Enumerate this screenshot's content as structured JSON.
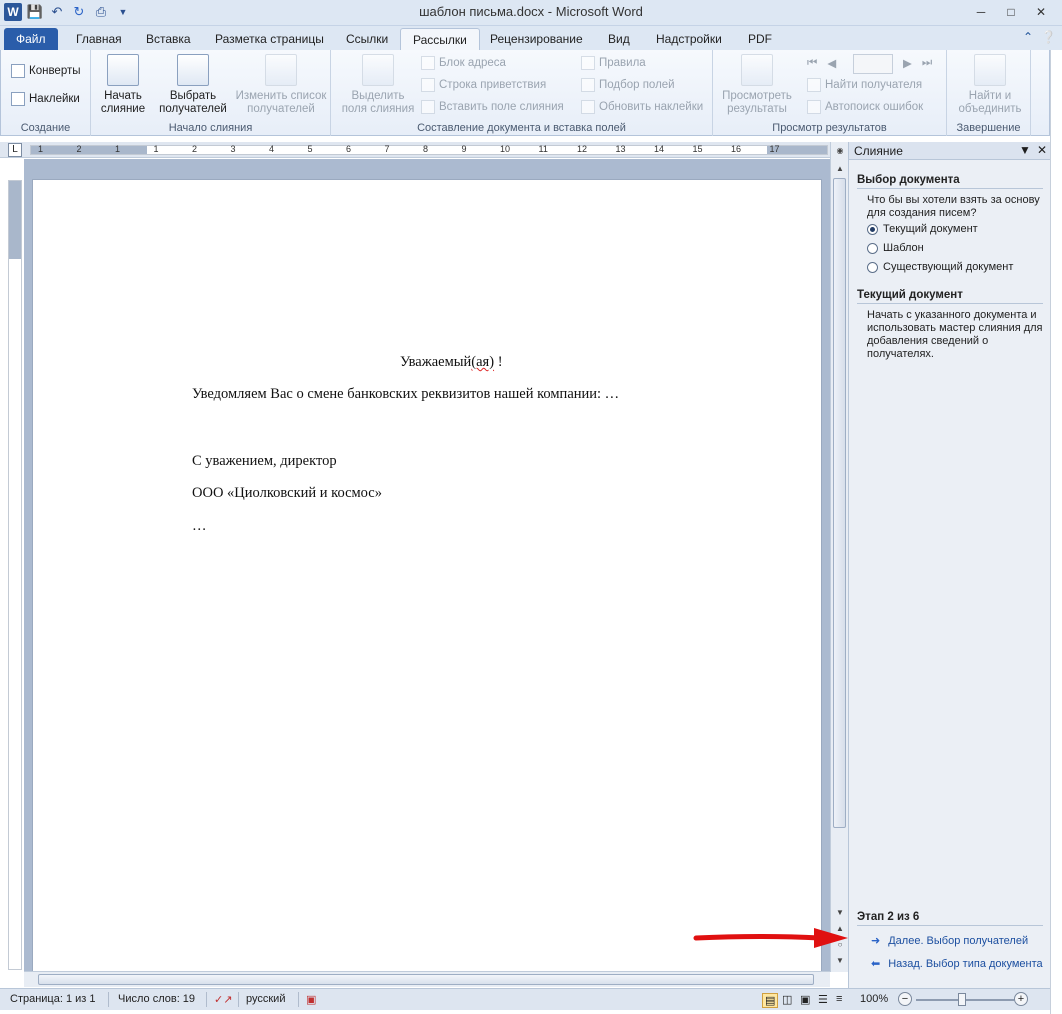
{
  "window": {
    "title": "шаблон письма.docx - Microsoft Word"
  },
  "tabs": [
    {
      "label": "Файл"
    },
    {
      "label": "Главная"
    },
    {
      "label": "Вставка"
    },
    {
      "label": "Разметка страницы"
    },
    {
      "label": "Ссылки"
    },
    {
      "label": "Рассылки"
    },
    {
      "label": "Рецензирование"
    },
    {
      "label": "Вид"
    },
    {
      "label": "Надстройки"
    },
    {
      "label": "PDF"
    }
  ],
  "ribbon": {
    "create": {
      "label": "Создание",
      "envelopes": "Конверты",
      "labels": "Наклейки"
    },
    "start_merge": {
      "label": "Начало слияния",
      "start_line1": "Начать",
      "start_line2": "слияние",
      "select_line1": "Выбрать",
      "select_line2": "получателей",
      "edit_line1": "Изменить список",
      "edit_line2": "получателей"
    },
    "compose": {
      "label": "Составление документа и вставка полей",
      "highlight_line1": "Выделить",
      "highlight_line2": "поля слияния",
      "address_block": "Блок адреса",
      "greeting_line": "Строка приветствия",
      "insert_field": "Вставить поле слияния",
      "rules": "Правила",
      "match_fields": "Подбор полей",
      "update_labels": "Обновить наклейки"
    },
    "preview": {
      "label": "Просмотр результатов",
      "preview_line1": "Просмотреть",
      "preview_line2": "результаты",
      "find_recipient": "Найти получателя",
      "auto_check": "Автопоиск ошибок"
    },
    "finish": {
      "label": "Завершение",
      "finish_line1": "Найти и",
      "finish_line2": "объединить"
    }
  },
  "document": {
    "greeting_prefix": "Уважаемый",
    "greeting_suffix": "(ая)",
    "greeting_end": " !",
    "line1": "Уведомляем Вас о смене банковских реквизитов нашей компании: …",
    "line2": "С уважением, директор",
    "line3": "ООО «Циолковский и космос»",
    "line4": "…"
  },
  "pane": {
    "title": "Слияние",
    "section1_title": "Выбор документа",
    "section1_question": "Что бы вы хотели взять за основу для создания писем?",
    "radio_current": "Текущий документ",
    "radio_template": "Шаблон",
    "radio_existing": "Существующий документ",
    "section2_title": "Текущий документ",
    "section2_text": "Начать с указанного документа и использовать мастер слияния для добавления сведений о получателях.",
    "step": "Этап 2 из 6",
    "next_link": "Далее. Выбор получателей",
    "back_link": "Назад. Выбор типа документа"
  },
  "status": {
    "page": "Страница: 1 из 1",
    "words": "Число слов: 19",
    "language": "русский",
    "zoom": "100%"
  },
  "ruler": {
    "ticks": [
      "1",
      "2",
      "1",
      "1",
      "2",
      "3",
      "4",
      "5",
      "6",
      "7",
      "8",
      "9",
      "10",
      "11",
      "12",
      "13",
      "14",
      "15",
      "16",
      "17"
    ]
  },
  "colors": {
    "accent": "#2a5daa",
    "link": "#1c4fa0",
    "arrow": "#e01010"
  }
}
